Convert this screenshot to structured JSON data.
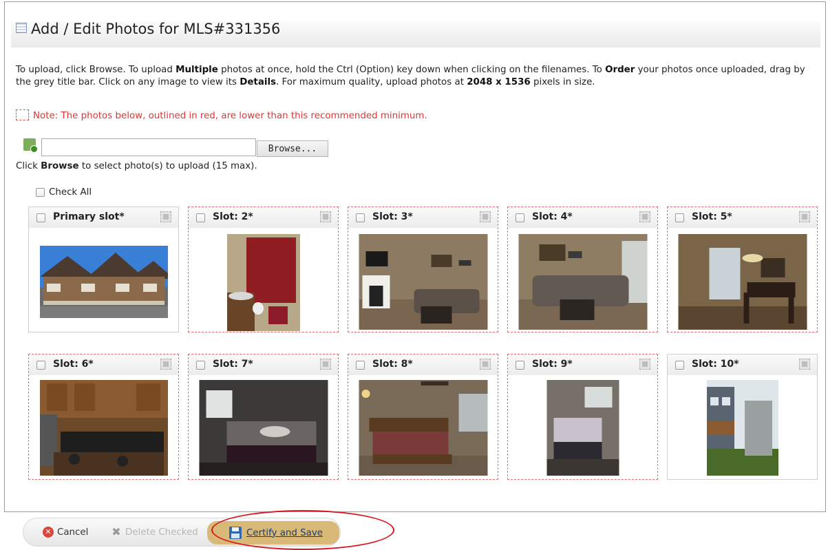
{
  "header": {
    "title": "Add / Edit Photos for MLS#331356"
  },
  "instructions": {
    "t1": "To upload, click Browse. To upload ",
    "b1": "Multiple",
    "t2": " photos at once, hold the Ctrl (Option) key down when clicking on the filenames. To ",
    "b2": "Order",
    "t3": " your photos once uploaded, drag by the grey title bar. Click on any image to view its ",
    "b3": "Details",
    "t4": ". For maximum quality, upload photos at ",
    "b4": "2048 x 1536",
    "t5": " pixels in size."
  },
  "note": "Note: The photos below, outlined in red, are lower than this recommended minimum.",
  "upload": {
    "input_value": "",
    "browse_label": "Browse...",
    "hint_pre": "Click ",
    "hint_bold": "Browse",
    "hint_post": " to select photo(s) to upload (15 max)."
  },
  "check_all_label": "Check All",
  "slots": [
    {
      "label": "Primary slot*",
      "low_res": false,
      "photo": "house-exterior"
    },
    {
      "label": "Slot: 2*",
      "low_res": true,
      "photo": "bathroom"
    },
    {
      "label": "Slot: 3*",
      "low_res": true,
      "photo": "living-room-fireplace"
    },
    {
      "label": "Slot: 4*",
      "low_res": true,
      "photo": "living-room-sectional"
    },
    {
      "label": "Slot: 5*",
      "low_res": true,
      "photo": "dining-room"
    },
    {
      "label": "Slot: 6*",
      "low_res": true,
      "photo": "kitchen"
    },
    {
      "label": "Slot: 7*",
      "low_res": true,
      "photo": "bedroom"
    },
    {
      "label": "Slot: 8*",
      "low_res": true,
      "photo": "master-bedroom"
    },
    {
      "label": "Slot: 9*",
      "low_res": true,
      "photo": "bedroom-2"
    },
    {
      "label": "Slot: 10*",
      "low_res": false,
      "photo": "exterior-side"
    }
  ],
  "footer": {
    "cancel_label": "Cancel",
    "delete_label": "Delete Checked",
    "save_label": "Certify and Save"
  },
  "colors": {
    "accent_save": "#d9b978",
    "low_res_outline": "#e66a6a",
    "note_text": "#e03434",
    "highlight_ellipse": "#d7151e"
  }
}
